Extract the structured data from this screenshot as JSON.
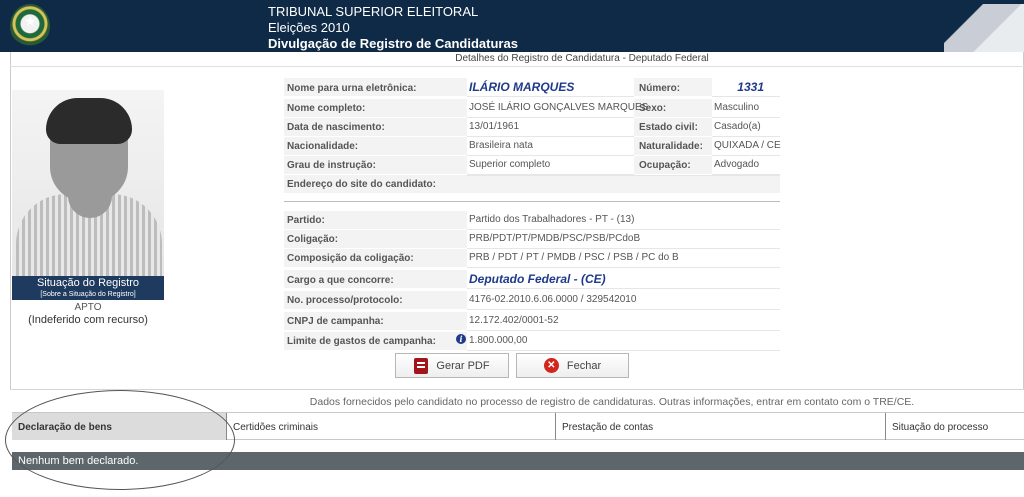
{
  "header": {
    "line1": "TRIBUNAL SUPERIOR ELEITORAL",
    "line2": "Eleições 2010",
    "line3": "Divulgação de Registro de Candidaturas"
  },
  "subtitle": "Detalhes do Registro de Candidatura - Deputado Federal",
  "situacao": {
    "title": "Situação do Registro",
    "link": "[Sobre a Situação do Registro]",
    "status": "APTO",
    "note": "(Indeferido com recurso)"
  },
  "fields": {
    "nome_urna_label": "Nome para urna eletrônica:",
    "nome_urna": "ILÁRIO MARQUES",
    "numero_label": "Número:",
    "numero": "1331",
    "nome_completo_label": "Nome completo:",
    "nome_completo": "JOSÉ ILÁRIO GONÇALVES MARQUES",
    "sexo_label": "Sexo:",
    "sexo": "Masculino",
    "nascimento_label": "Data de nascimento:",
    "nascimento": "13/01/1961",
    "estado_civil_label": "Estado civil:",
    "estado_civil": "Casado(a)",
    "nacionalidade_label": "Nacionalidade:",
    "nacionalidade": "Brasileira nata",
    "naturalidade_label": "Naturalidade:",
    "naturalidade": "QUIXADA / CE",
    "grau_label": "Grau de instrução:",
    "grau": "Superior completo",
    "ocupacao_label": "Ocupação:",
    "ocupacao": "Advogado",
    "site_label": "Endereço do site do candidato:",
    "site": "",
    "partido_label": "Partido:",
    "partido": "Partido dos Trabalhadores - PT - (13)",
    "coligacao_label": "Coligação:",
    "coligacao": "PRB/PDT/PT/PMDB/PSC/PSB/PCdoB",
    "composicao_label": "Composição da coligação:",
    "composicao": "PRB / PDT / PT / PMDB / PSC / PSB / PC do B",
    "cargo_label": "Cargo a que concorre:",
    "cargo": "Deputado Federal - (CE)",
    "processo_label": "No. processo/protocolo:",
    "processo": "4176-02.2010.6.06.0000 / 329542010",
    "cnpj_label": "CNPJ de campanha:",
    "cnpj": "12.172.402/0001-52",
    "limite_label": "Limite de gastos de campanha:",
    "limite": "1.800.000,00"
  },
  "buttons": {
    "pdf": "Gerar PDF",
    "close": "Fechar"
  },
  "footer": {
    "note": "Dados fornecidos pelo candidato no processo de registro de candidaturas. Outras informações, entrar em contato com o TRE/CE.",
    "tabs": [
      "Declaração de bens",
      "Certidões criminais",
      "Prestação de contas",
      "Situação do processo"
    ],
    "bens_message": "Nenhum bem declarado."
  }
}
